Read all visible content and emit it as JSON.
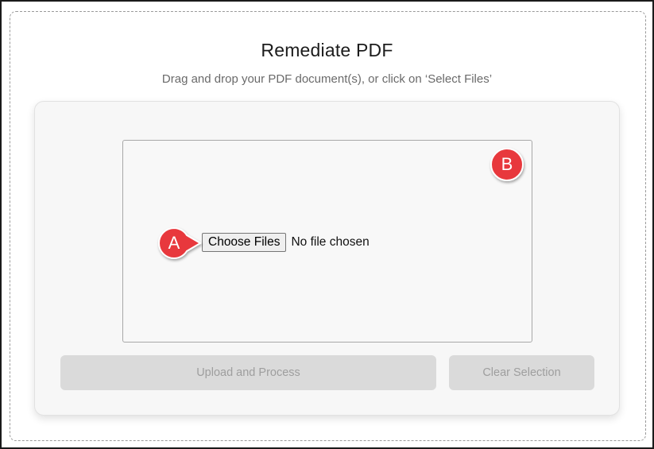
{
  "header": {
    "title": "Remediate PDF",
    "subtitle": "Drag and drop your PDF document(s), or click on ‘Select Files’"
  },
  "file_input": {
    "button_label": "Choose Files",
    "status_text": "No file chosen"
  },
  "actions": {
    "upload_label": "Upload and Process",
    "clear_label": "Clear Selection"
  },
  "callouts": {
    "a_label": "A",
    "b_label": "B",
    "color": "#e8393c"
  },
  "colors": {
    "disabled_button_bg": "#dadada",
    "disabled_button_text": "#9e9e9e",
    "card_bg": "#f7f7f7"
  }
}
